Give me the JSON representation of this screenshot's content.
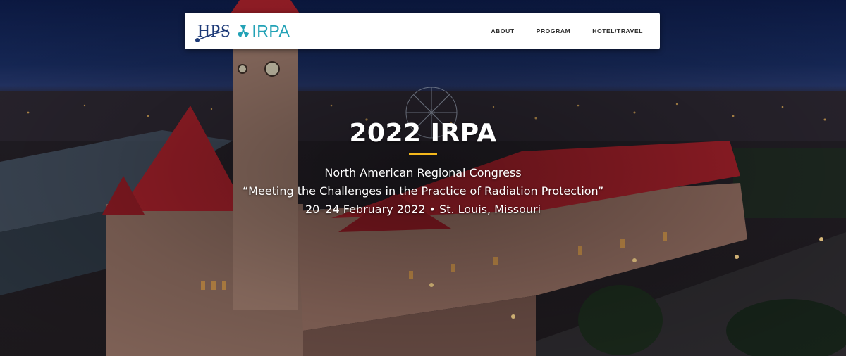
{
  "logo": {
    "hps": "HPS",
    "irpa": "IRPA"
  },
  "nav": {
    "items": [
      {
        "label": "ABOUT"
      },
      {
        "label": "PROGRAM"
      },
      {
        "label": "HOTEL/TRAVEL"
      }
    ]
  },
  "hero": {
    "title": "2022 IRPA",
    "subtitle": "North American Regional Congress",
    "theme": "“Meeting the Challenges in the Practice of Radiation Protection”",
    "dates_location": "20–24 February 2022 • St. Louis, Missouri"
  },
  "colors": {
    "accent_divider": "#f4b81c",
    "hps_blue": "#1d3a78",
    "irpa_teal": "#23a2b6",
    "roof_red": "#a3202a"
  }
}
